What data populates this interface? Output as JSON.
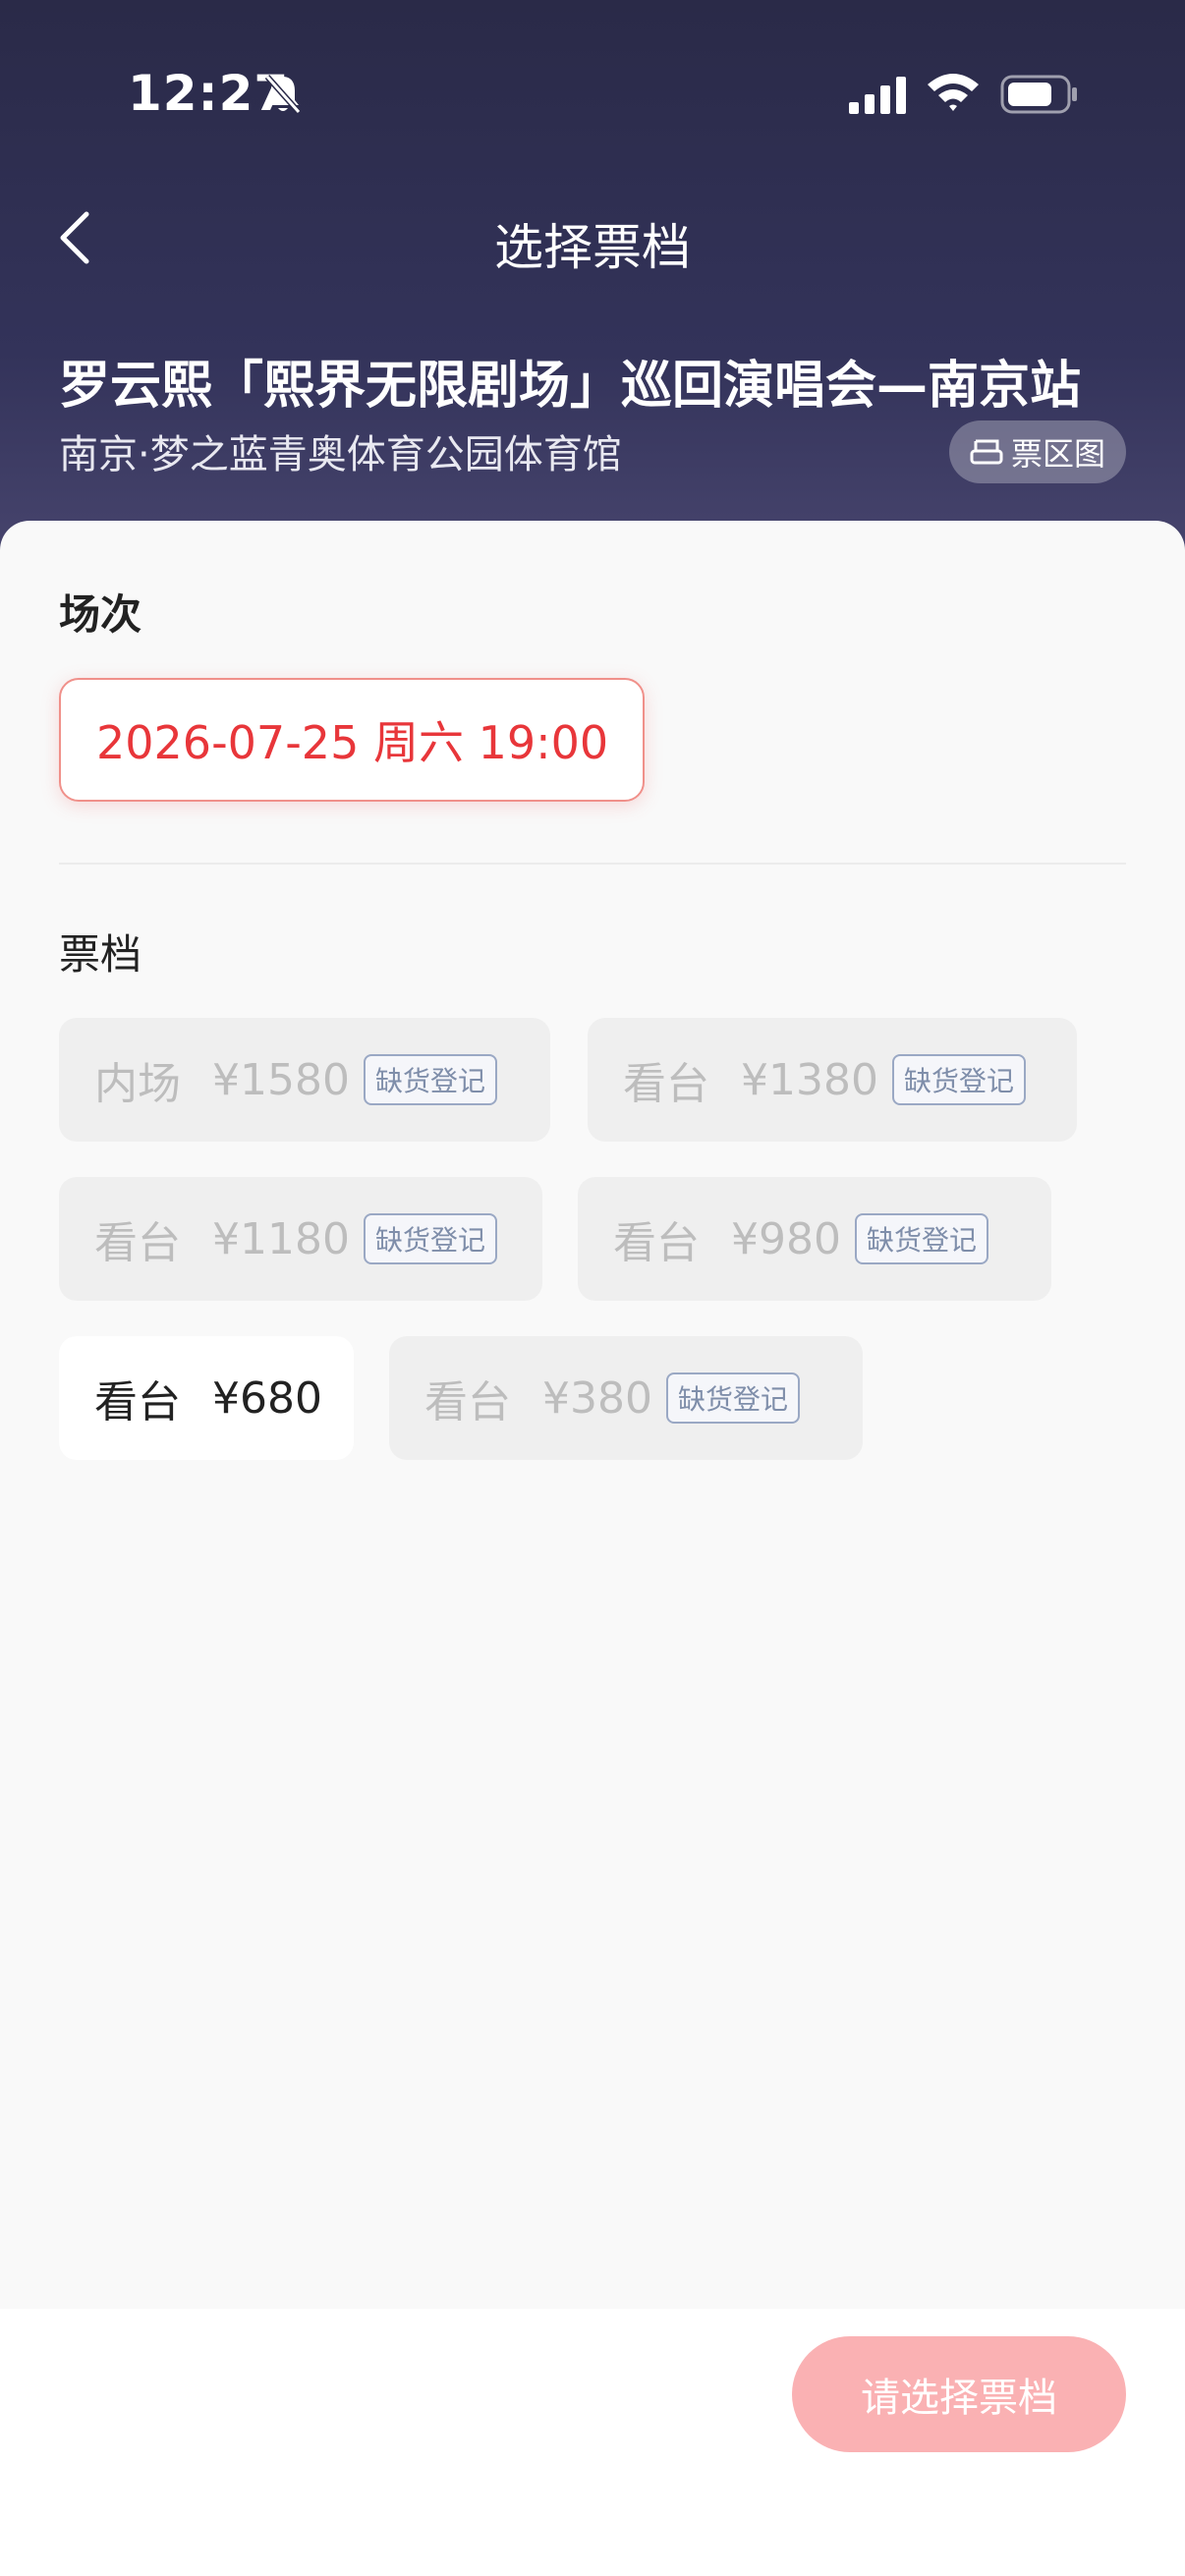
{
  "status_bar": {
    "time": "12:27"
  },
  "nav": {
    "title": "选择票档"
  },
  "event": {
    "title": "罗云熙「熙界无限剧场」巡回演唱会—南京站",
    "venue": "南京·梦之蓝青奥体育公园体育馆",
    "map_button_label": "票区图"
  },
  "sessions": {
    "label": "场次",
    "selected": "2026-07-25 周六 19:00"
  },
  "tiers": {
    "label": "票档",
    "items": [
      {
        "zone": "内场",
        "price": "¥1580",
        "badge": "缺货登记",
        "available": false
      },
      {
        "zone": "看台",
        "price": "¥1380",
        "badge": "缺货登记",
        "available": false
      },
      {
        "zone": "看台",
        "price": "¥1180",
        "badge": "缺货登记",
        "available": false
      },
      {
        "zone": "看台",
        "price": "¥980",
        "badge": "缺货登记",
        "available": false
      },
      {
        "zone": "看台",
        "price": "¥680",
        "badge": "",
        "available": true
      },
      {
        "zone": "看台",
        "price": "¥380",
        "badge": "缺货登记",
        "available": false
      }
    ]
  },
  "footer": {
    "confirm_label": "请选择票档"
  },
  "colors": {
    "accent": "#e8363a",
    "button": "#fab1b3",
    "header": "#2a2a48"
  }
}
